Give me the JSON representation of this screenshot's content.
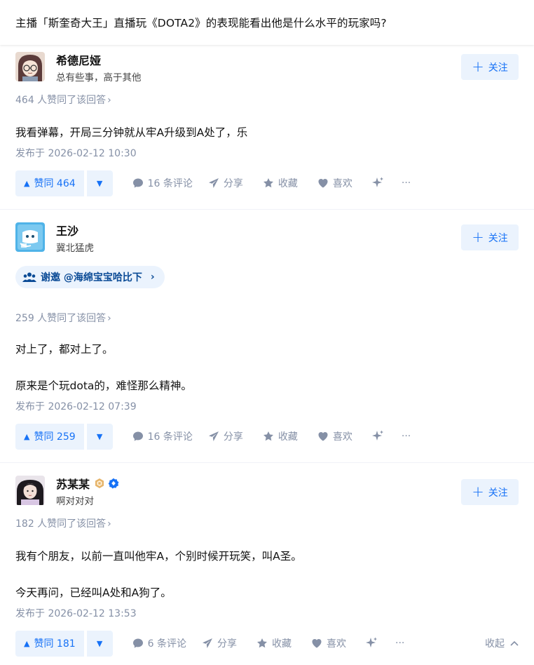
{
  "question": {
    "title": "主播「斯奎奇大王」直播玩《DOTA2》的表现能看出他是什么水平的玩家吗?"
  },
  "common": {
    "follow_label": "关注",
    "share_label": "分享",
    "favorite_label": "收藏",
    "like_label": "喜欢",
    "more_label": "···",
    "collapse_label": "收起",
    "upvote_suffix": "人赞同了该回答",
    "up_prefix": "赞同"
  },
  "colors": {
    "accent": "#1772f6",
    "accent_bg": "#ebf3fd",
    "muted": "#8590a6",
    "invite_text": "#0b4b96"
  },
  "answers": [
    {
      "author_name": "希德尼娅",
      "author_bio": "总有些事，高于其他",
      "upvote_line": "464 人赞同了该回答",
      "paragraphs": [
        "我看弹幕，开局三分钟就从牢A升级到A处了，乐"
      ],
      "date": "发布于 2026-02-12 10:30",
      "vote_label": "赞同 464",
      "comment_label": "16 条评论"
    },
    {
      "author_name": "王沙",
      "author_bio": "冀北猛虎",
      "invite_label": "谢邀 @海绵宝宝哈比下",
      "upvote_line": "259 人赞同了该回答",
      "paragraphs": [
        "对上了，都对上了。",
        "原来是个玩dota的，难怪那么精神。"
      ],
      "date": "发布于 2026-02-12 07:39",
      "vote_label": "赞同 259",
      "comment_label": "16 条评论"
    },
    {
      "author_name": "苏某某",
      "author_bio": "啊对对对",
      "upvote_line": "182 人赞同了该回答",
      "paragraphs": [
        "我有个朋友，以前一直叫他牢A，个别时候开玩笑，叫A圣。",
        "今天再问，已经叫A处和A狗了。"
      ],
      "date": "发布于 2026-02-12 13:53",
      "vote_label": "赞同 181",
      "comment_label": "6 条评论"
    }
  ],
  "icons": {
    "follow": "plus-icon",
    "vote_up": "triangle-up-icon",
    "vote_down": "triangle-down-icon",
    "comment": "comment-bubble-icon",
    "share": "paper-plane-icon",
    "favorite": "star-icon",
    "like": "heart-icon",
    "ai": "sparkle-icon",
    "invite": "people-icon",
    "badges": [
      "hexagon-badge-icon",
      "verified-badge-icon"
    ]
  }
}
